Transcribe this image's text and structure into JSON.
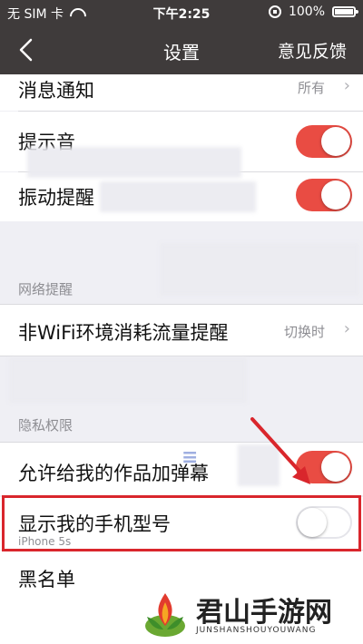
{
  "status_bar": {
    "carrier": "无 SIM 卡",
    "time": "下午2:25",
    "battery": "100%"
  },
  "nav": {
    "title": "设置",
    "right_action": "意见反馈"
  },
  "rows": {
    "notifications": {
      "label": "消息通知",
      "value": "所有"
    },
    "sound": {
      "label": "提示音",
      "on": true
    },
    "vibration": {
      "label": "振动提醒",
      "on": true
    },
    "network_header": "网络提醒",
    "non_wifi": {
      "label": "非WiFi环境消耗流量提醒",
      "value": "切换时"
    },
    "privacy_header": "隐私权限",
    "allow_danmu": {
      "label": "允许给我的作品加弹幕",
      "on": true
    },
    "show_model": {
      "label": "显示我的手机型号",
      "sub": "iPhone 5s",
      "on": false
    },
    "blacklist": {
      "label": "黑名单"
    }
  },
  "watermark": {
    "site_name": "君山手游网",
    "site_url": "JUNSHANSHOUYOUWANG"
  },
  "colors": {
    "nav_bg": "#3f3b3b",
    "toggle_on": "#e94c43",
    "highlight": "#d9262c"
  }
}
